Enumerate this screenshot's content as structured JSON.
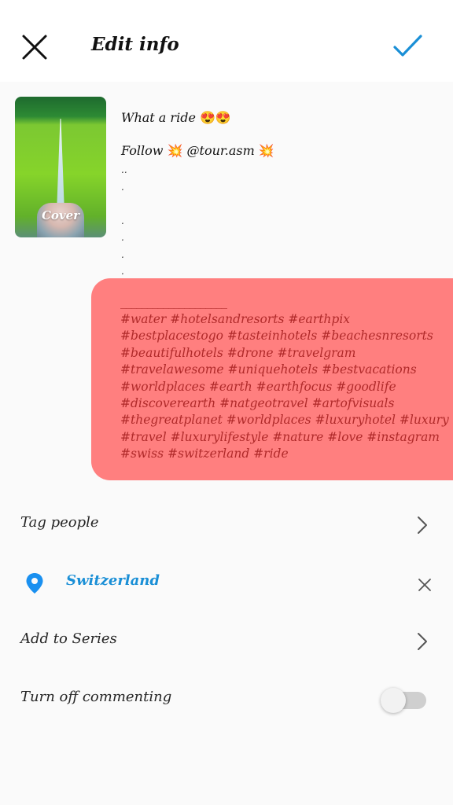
{
  "header": {
    "title": "Edit info",
    "close_icon": "close-icon",
    "confirm_icon": "checkmark-icon",
    "accent_color": "#1a8fd6"
  },
  "post": {
    "thumbnail_label": "Cover",
    "caption": {
      "line1_text": "What a ride",
      "line1_emoji": "😍😍",
      "line2_prefix": "Follow",
      "line2_emoji_a": "💥",
      "line2_mention": "@tour.asm",
      "line2_emoji_b": "💥",
      "dot_lines": [
        "..",
        ".",
        "",
        ".",
        ".",
        ".",
        "."
      ]
    },
    "hashtags": {
      "separator": "____________________",
      "lines": [
        "#water #hotelsandresorts  #earthpix",
        "#bestplacestogo #tasteinhotels #beachesnresorts",
        "#beautifulhotels  #drone #travelgram",
        "#travelawesome #uniquehotels #bestvacations",
        "#worldplaces #earth #earthfocus #goodlife",
        "#discoverearth #natgeotravel #artofvisuals",
        "#thegreatplanet  #worldplaces #luxuryhotel #luxury",
        "#travel #luxurylifestyle #nature #love #instagram",
        "#swiss #switzerland #ride"
      ],
      "highlight_color": "#ff7f7f"
    }
  },
  "options": {
    "tag_people": "Tag people",
    "location": "Switzerland",
    "add_to_series": "Add to Series",
    "turn_off_commenting": "Turn off commenting",
    "commenting_off": false
  }
}
